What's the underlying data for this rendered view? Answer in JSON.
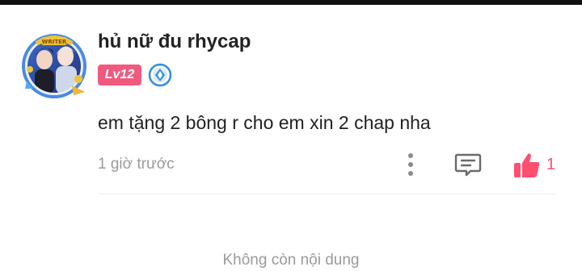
{
  "comment": {
    "username": "hủ nữ đu rhycap",
    "level_badge": "Lv12",
    "text": "em tặng 2 bông r cho em xin 2 chap nha",
    "timestamp": "1 giờ trước",
    "like_count": "1",
    "avatar_frame_label": "WRITER"
  },
  "footer": {
    "end_text": "Không còn nội dung"
  },
  "colors": {
    "level_badge": "#f05a7e",
    "like_active": "#ff4f6e",
    "rank_badge": "#2f8fe0",
    "muted_text": "#9a9a9a"
  },
  "icons": {
    "more": "more-vertical-icon",
    "reply": "comment-reply-icon",
    "like": "thumbs-up-icon",
    "rank": "diamond-rank-icon"
  }
}
